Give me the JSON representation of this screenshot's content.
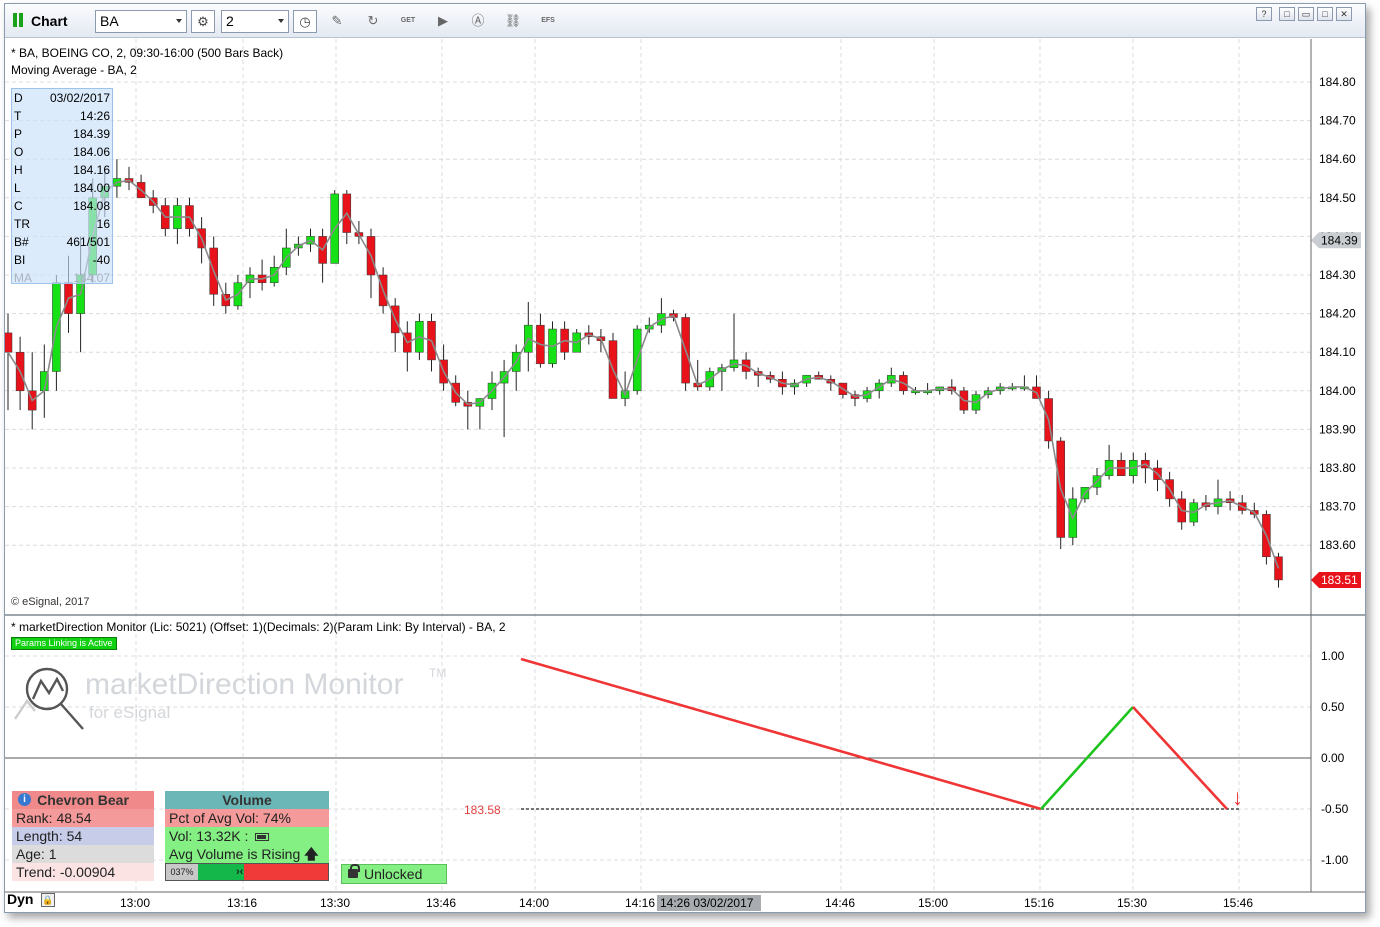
{
  "toolbar": {
    "title": "Chart",
    "symbol": "BA",
    "interval": "2",
    "efs_label": "EFS",
    "gt_label": "GET"
  },
  "window_buttons": [
    "?",
    "□",
    "▭",
    "□",
    "✕"
  ],
  "price_pane": {
    "header_line1": "* BA, BOEING CO, 2, 09:30-16:00 (500 Bars Back)",
    "header_line2": "Moving Average - BA, 2",
    "copyright": "© eSignal, 2017",
    "y_ticks": [
      "184.80",
      "184.70",
      "184.60",
      "184.50",
      "184.40",
      "184.30",
      "184.20",
      "184.10",
      "184.00",
      "183.90",
      "183.80",
      "183.70",
      "183.60"
    ],
    "last_price_flag": "184.39",
    "current_price_flag": "183.51",
    "colors": {
      "up": "#16e016",
      "down": "#e8131a",
      "ma": "#8a8a8a",
      "grid": "#dcdcdc"
    }
  },
  "info_panel": [
    {
      "k": "D",
      "v": "03/02/2017"
    },
    {
      "k": "T",
      "v": "14:26"
    },
    {
      "k": "P",
      "v": "184.39"
    },
    {
      "k": "O",
      "v": "184.06"
    },
    {
      "k": "H",
      "v": "184.16"
    },
    {
      "k": "L",
      "v": "184.00"
    },
    {
      "k": "C",
      "v": "184.08"
    },
    {
      "k": "TR",
      "v": "16"
    },
    {
      "k": "B#",
      "v": "461/501"
    },
    {
      "k": "BI",
      "v": "-40"
    },
    {
      "k": "MA",
      "v": "184.07"
    }
  ],
  "indicator_pane": {
    "header": "* marketDirection Monitor (Lic: 5021) (Offset: 1)(Decimals: 2)(Param Link: By Interval) - BA, 2",
    "params_badge": "Params Linking is Active",
    "logo_text": "marketDirection Monitor",
    "logo_sub": "for eSignal",
    "logo_tm": "TM",
    "y_ticks": [
      "1.00",
      "0.50",
      "0.00",
      "-0.50",
      "-1.00"
    ],
    "level_label": "183.58",
    "arrow_glyph": "↓"
  },
  "chevron_box": {
    "title": "Chevron Bear",
    "rank": "Rank: 48.54",
    "length": "Length: 54",
    "age": "Age: 1",
    "trend": "Trend: -0.00904"
  },
  "volume_box": {
    "title": "Volume",
    "pct": "Pct of Avg Vol: 74%",
    "vol": "Vol: 13.32K :",
    "rising": "Avg Volume is Rising",
    "gauge_label": "037%"
  },
  "lock_button": {
    "label": "Unlocked"
  },
  "time_axis": {
    "dyn_label": "Dyn",
    "labels": [
      "13:00",
      "13:16",
      "13:30",
      "13:46",
      "14:00",
      "14:16",
      "14:46",
      "15:00",
      "15:16",
      "15:30",
      "15:46"
    ],
    "cursor_label": "14:26 03/02/2017"
  }
}
